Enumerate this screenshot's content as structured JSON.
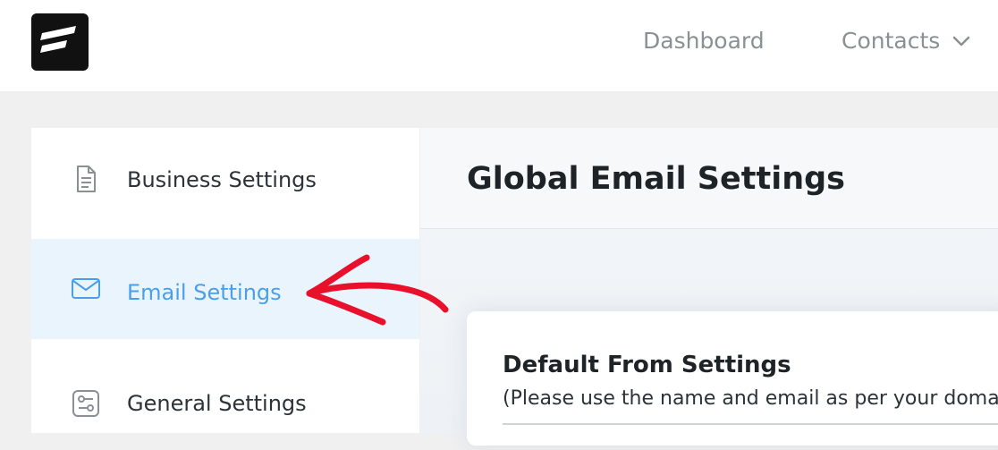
{
  "header": {
    "logo_icon": "brand-logo-icon",
    "nav": {
      "dashboard_label": "Dashboard",
      "contacts_label": "Contacts",
      "contacts_icon": "chevron-down-icon"
    }
  },
  "sidebar": {
    "items": [
      {
        "label": "Business Settings",
        "icon": "document-icon",
        "active": false
      },
      {
        "label": "Email Settings",
        "icon": "envelope-icon",
        "active": true
      },
      {
        "label": "General Settings",
        "icon": "sliders-icon",
        "active": false
      }
    ]
  },
  "main": {
    "title": "Global Email Settings",
    "card": {
      "title": "Default From Settings",
      "subtitle": "(Please use the name and email as per your domain"
    }
  },
  "annotation": {
    "arrow_color": "#e8102a"
  },
  "colors": {
    "accent": "#4a9fe8",
    "active_bg": "#eaf4fd"
  }
}
